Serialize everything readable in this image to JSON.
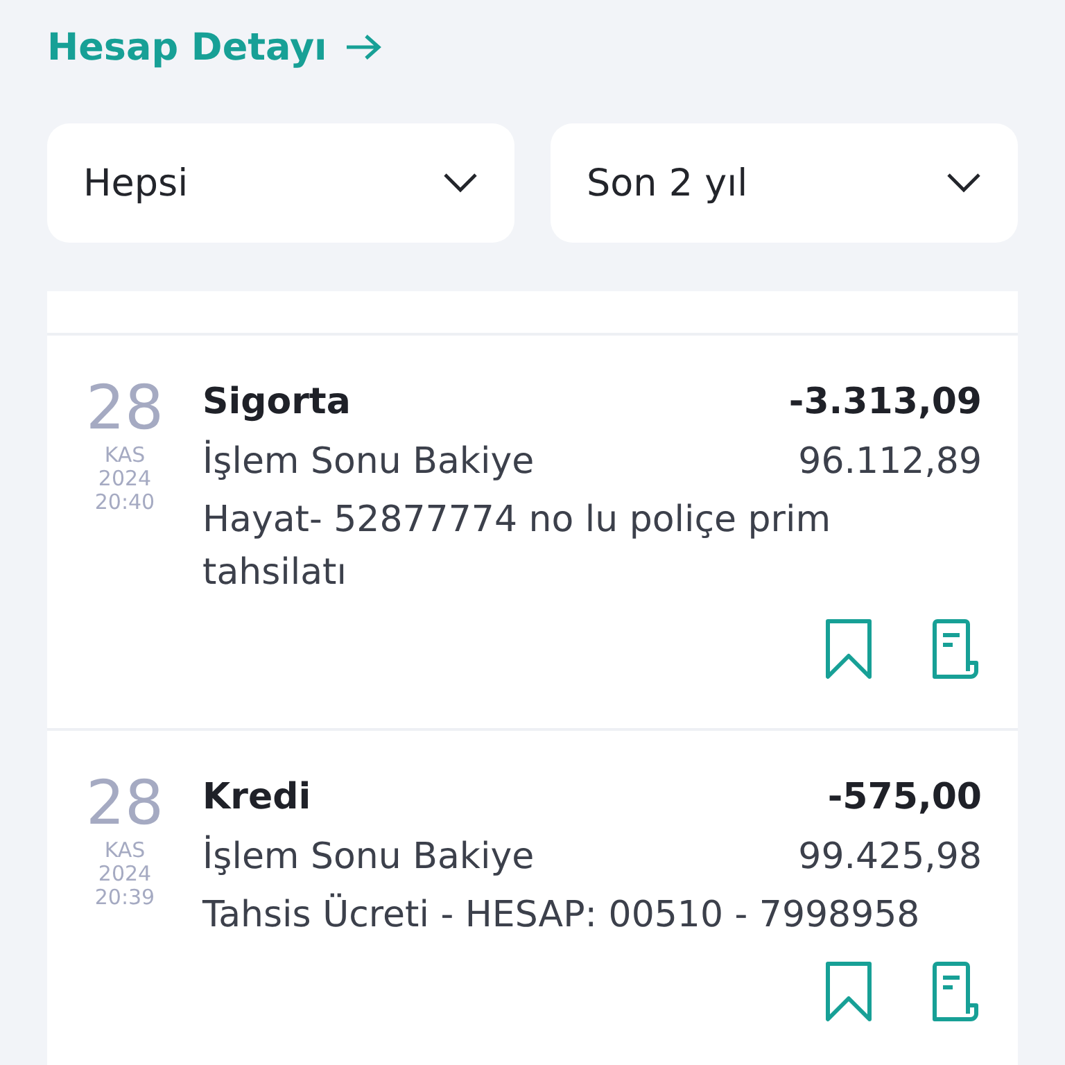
{
  "header": {
    "link": "Hesap Detayı"
  },
  "filters": [
    {
      "value": "Hepsi"
    },
    {
      "value": "Son 2 yıl"
    }
  ],
  "transactions": [
    {
      "day": "28",
      "month": "KAS",
      "year": "2024",
      "time": "20:40",
      "title": "Sigorta",
      "amount": "-3.313,09",
      "balance_label": "İşlem Sonu Bakiye",
      "balance": "96.112,89",
      "description": "Hayat- 52877774 no lu poliçe prim tahsilatı"
    },
    {
      "day": "28",
      "month": "KAS",
      "year": "2024",
      "time": "20:39",
      "title": "Kredi",
      "amount": "-575,00",
      "balance_label": "İşlem Sonu Bakiye",
      "balance": "99.425,98",
      "description": "Tahsis Ücreti - HESAP: 00510 - 7998958"
    }
  ]
}
